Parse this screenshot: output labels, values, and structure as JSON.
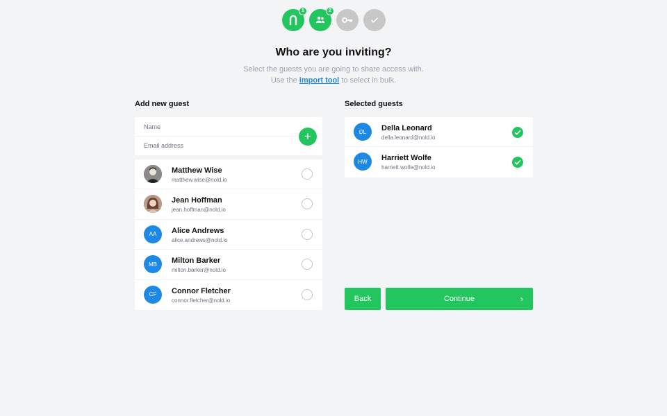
{
  "stepper": {
    "steps": [
      {
        "icon": "n-logo-icon",
        "badge": "1",
        "active": true
      },
      {
        "icon": "users-icon",
        "badge": "2",
        "active": true
      },
      {
        "icon": "key-icon",
        "badge": "",
        "active": false
      },
      {
        "icon": "checkmark-icon",
        "badge": "",
        "active": false
      }
    ]
  },
  "header": {
    "title": "Who are you inviting?",
    "subtitle_line1": "Select the guests you are going to share access with.",
    "subtitle_line2_prefix": "Use the",
    "import_link": "import tool",
    "subtitle_line2_suffix": "to select in bulk."
  },
  "add_guest": {
    "heading": "Add new guest",
    "name_placeholder": "Name",
    "email_placeholder": "Email address",
    "add_button": "+"
  },
  "guests": [
    {
      "name": "Matthew Wise",
      "email": "matthew.wise@nold.io",
      "initials": "",
      "avatar": "photo"
    },
    {
      "name": "Jean Hoffman",
      "email": "jean.hoffman@nold.io",
      "initials": "",
      "avatar": "photo"
    },
    {
      "name": "Alice Andrews",
      "email": "alice.andrews@nold.io",
      "initials": "AA",
      "avatar": "initials"
    },
    {
      "name": "Milton Barker",
      "email": "milton.barker@nold.io",
      "initials": "MB",
      "avatar": "initials"
    },
    {
      "name": "Connor Fletcher",
      "email": "connor.fletcher@nold.io",
      "initials": "CF",
      "avatar": "initials"
    }
  ],
  "selected": {
    "heading": "Selected guests",
    "items": [
      {
        "name": "Della Leonard",
        "email": "della.leonard@nold.io",
        "initials": "DL"
      },
      {
        "name": "Harriett Wolfe",
        "email": "harriett.wolfe@nold.io",
        "initials": "HW"
      }
    ]
  },
  "actions": {
    "back": "Back",
    "continue": "Continue"
  },
  "colors": {
    "accent": "#22c55e",
    "avatar_blue": "#1e88e5",
    "inactive_step": "#c7c7c7",
    "background": "#f3f4f6"
  }
}
